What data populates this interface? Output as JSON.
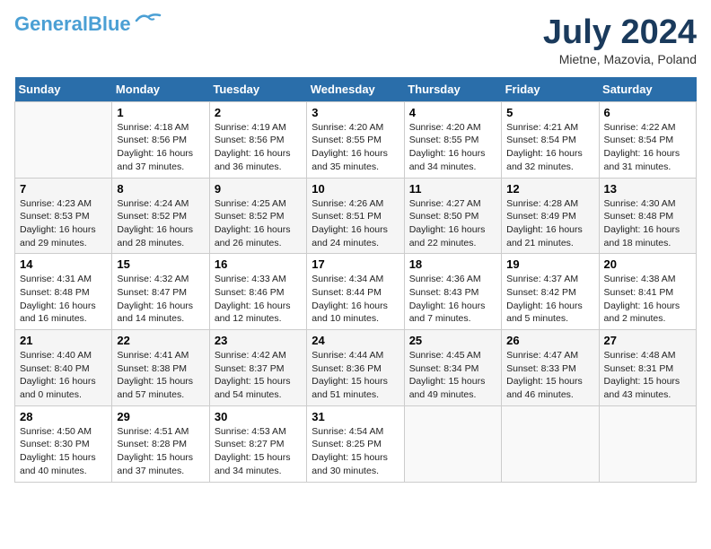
{
  "header": {
    "logo": {
      "part1": "General",
      "part2": "Blue"
    },
    "title": "July 2024",
    "location": "Mietne, Mazovia, Poland"
  },
  "columns": [
    "Sunday",
    "Monday",
    "Tuesday",
    "Wednesday",
    "Thursday",
    "Friday",
    "Saturday"
  ],
  "weeks": [
    [
      {
        "day": "",
        "info": ""
      },
      {
        "day": "1",
        "info": "Sunrise: 4:18 AM\nSunset: 8:56 PM\nDaylight: 16 hours\nand 37 minutes."
      },
      {
        "day": "2",
        "info": "Sunrise: 4:19 AM\nSunset: 8:56 PM\nDaylight: 16 hours\nand 36 minutes."
      },
      {
        "day": "3",
        "info": "Sunrise: 4:20 AM\nSunset: 8:55 PM\nDaylight: 16 hours\nand 35 minutes."
      },
      {
        "day": "4",
        "info": "Sunrise: 4:20 AM\nSunset: 8:55 PM\nDaylight: 16 hours\nand 34 minutes."
      },
      {
        "day": "5",
        "info": "Sunrise: 4:21 AM\nSunset: 8:54 PM\nDaylight: 16 hours\nand 32 minutes."
      },
      {
        "day": "6",
        "info": "Sunrise: 4:22 AM\nSunset: 8:54 PM\nDaylight: 16 hours\nand 31 minutes."
      }
    ],
    [
      {
        "day": "7",
        "info": "Sunrise: 4:23 AM\nSunset: 8:53 PM\nDaylight: 16 hours\nand 29 minutes."
      },
      {
        "day": "8",
        "info": "Sunrise: 4:24 AM\nSunset: 8:52 PM\nDaylight: 16 hours\nand 28 minutes."
      },
      {
        "day": "9",
        "info": "Sunrise: 4:25 AM\nSunset: 8:52 PM\nDaylight: 16 hours\nand 26 minutes."
      },
      {
        "day": "10",
        "info": "Sunrise: 4:26 AM\nSunset: 8:51 PM\nDaylight: 16 hours\nand 24 minutes."
      },
      {
        "day": "11",
        "info": "Sunrise: 4:27 AM\nSunset: 8:50 PM\nDaylight: 16 hours\nand 22 minutes."
      },
      {
        "day": "12",
        "info": "Sunrise: 4:28 AM\nSunset: 8:49 PM\nDaylight: 16 hours\nand 21 minutes."
      },
      {
        "day": "13",
        "info": "Sunrise: 4:30 AM\nSunset: 8:48 PM\nDaylight: 16 hours\nand 18 minutes."
      }
    ],
    [
      {
        "day": "14",
        "info": "Sunrise: 4:31 AM\nSunset: 8:48 PM\nDaylight: 16 hours\nand 16 minutes."
      },
      {
        "day": "15",
        "info": "Sunrise: 4:32 AM\nSunset: 8:47 PM\nDaylight: 16 hours\nand 14 minutes."
      },
      {
        "day": "16",
        "info": "Sunrise: 4:33 AM\nSunset: 8:46 PM\nDaylight: 16 hours\nand 12 minutes."
      },
      {
        "day": "17",
        "info": "Sunrise: 4:34 AM\nSunset: 8:44 PM\nDaylight: 16 hours\nand 10 minutes."
      },
      {
        "day": "18",
        "info": "Sunrise: 4:36 AM\nSunset: 8:43 PM\nDaylight: 16 hours\nand 7 minutes."
      },
      {
        "day": "19",
        "info": "Sunrise: 4:37 AM\nSunset: 8:42 PM\nDaylight: 16 hours\nand 5 minutes."
      },
      {
        "day": "20",
        "info": "Sunrise: 4:38 AM\nSunset: 8:41 PM\nDaylight: 16 hours\nand 2 minutes."
      }
    ],
    [
      {
        "day": "21",
        "info": "Sunrise: 4:40 AM\nSunset: 8:40 PM\nDaylight: 16 hours\nand 0 minutes."
      },
      {
        "day": "22",
        "info": "Sunrise: 4:41 AM\nSunset: 8:38 PM\nDaylight: 15 hours\nand 57 minutes."
      },
      {
        "day": "23",
        "info": "Sunrise: 4:42 AM\nSunset: 8:37 PM\nDaylight: 15 hours\nand 54 minutes."
      },
      {
        "day": "24",
        "info": "Sunrise: 4:44 AM\nSunset: 8:36 PM\nDaylight: 15 hours\nand 51 minutes."
      },
      {
        "day": "25",
        "info": "Sunrise: 4:45 AM\nSunset: 8:34 PM\nDaylight: 15 hours\nand 49 minutes."
      },
      {
        "day": "26",
        "info": "Sunrise: 4:47 AM\nSunset: 8:33 PM\nDaylight: 15 hours\nand 46 minutes."
      },
      {
        "day": "27",
        "info": "Sunrise: 4:48 AM\nSunset: 8:31 PM\nDaylight: 15 hours\nand 43 minutes."
      }
    ],
    [
      {
        "day": "28",
        "info": "Sunrise: 4:50 AM\nSunset: 8:30 PM\nDaylight: 15 hours\nand 40 minutes."
      },
      {
        "day": "29",
        "info": "Sunrise: 4:51 AM\nSunset: 8:28 PM\nDaylight: 15 hours\nand 37 minutes."
      },
      {
        "day": "30",
        "info": "Sunrise: 4:53 AM\nSunset: 8:27 PM\nDaylight: 15 hours\nand 34 minutes."
      },
      {
        "day": "31",
        "info": "Sunrise: 4:54 AM\nSunset: 8:25 PM\nDaylight: 15 hours\nand 30 minutes."
      },
      {
        "day": "",
        "info": ""
      },
      {
        "day": "",
        "info": ""
      },
      {
        "day": "",
        "info": ""
      }
    ]
  ]
}
